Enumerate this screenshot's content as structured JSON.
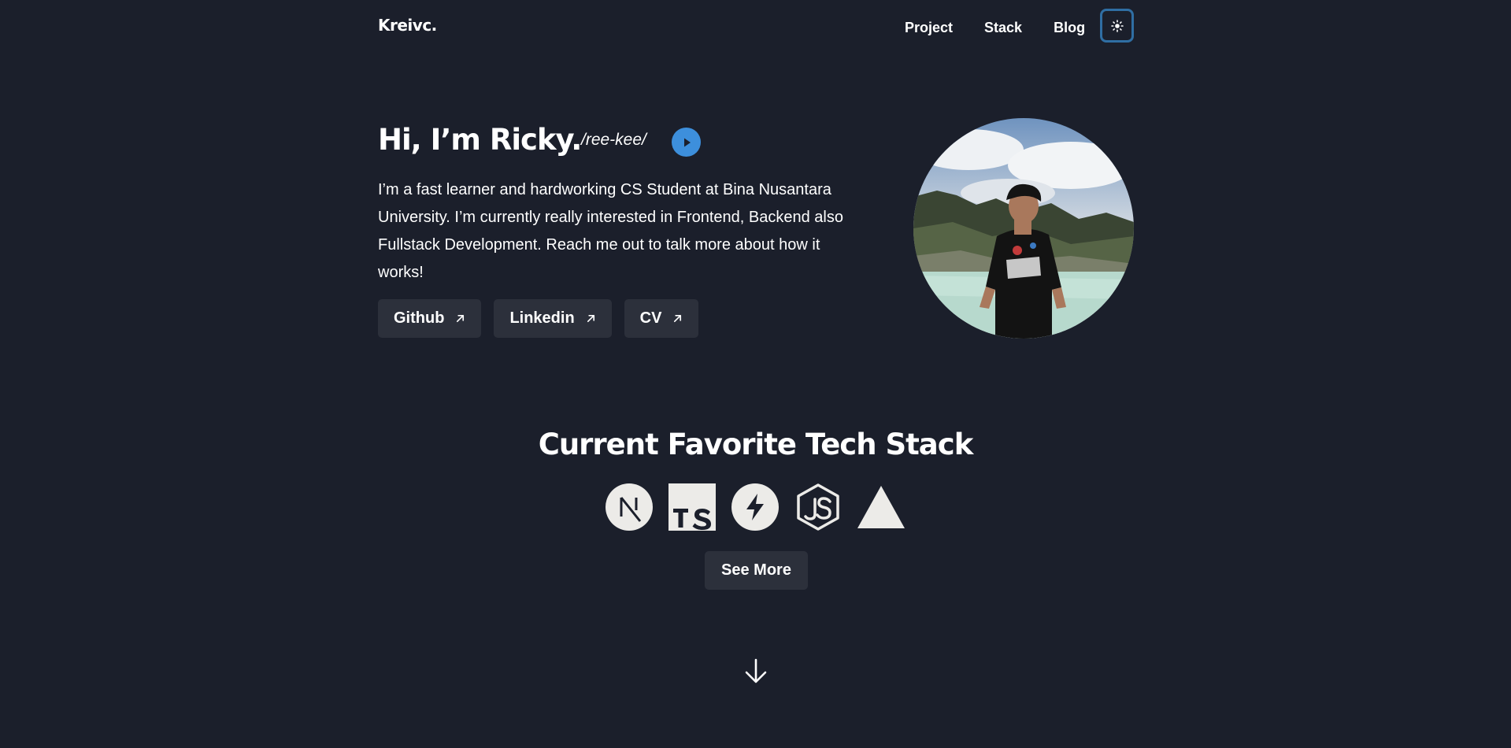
{
  "header": {
    "logo": "Kreivc.",
    "nav": [
      {
        "label": "Project"
      },
      {
        "label": "Stack"
      },
      {
        "label": "Blog"
      }
    ],
    "theme_toggle_icon": "sun-icon"
  },
  "hero": {
    "greeting": "Hi, I’m Ricky.",
    "pronunciation": "/ree-kee/",
    "play_icon": "play-icon",
    "bio": "I’m a fast learner and hardworking CS Student at Bina Nusantara University. I’m currently really interested in Frontend, Backend also Fullstack Development. Reach me out to talk more about how it works!",
    "links": [
      {
        "label": "Github",
        "icon": "external-arrow-icon"
      },
      {
        "label": "Linkedin",
        "icon": "external-arrow-icon"
      },
      {
        "label": "CV",
        "icon": "external-arrow-icon"
      }
    ],
    "avatar": "profile-photo"
  },
  "stack": {
    "title": "Current Favorite Tech Stack",
    "icons": [
      "nextjs-icon",
      "typescript-icon",
      "supabase-icon",
      "nodejs-icon",
      "vercel-icon"
    ],
    "see_more_label": "See More"
  },
  "scroll_icon": "arrow-down-icon",
  "colors": {
    "background": "#1b1f2b",
    "button_bg": "#2c303b",
    "accent_blue": "#3d8fdc",
    "toggle_border": "#2f6ea3",
    "icon_fill": "#ecebe8"
  }
}
